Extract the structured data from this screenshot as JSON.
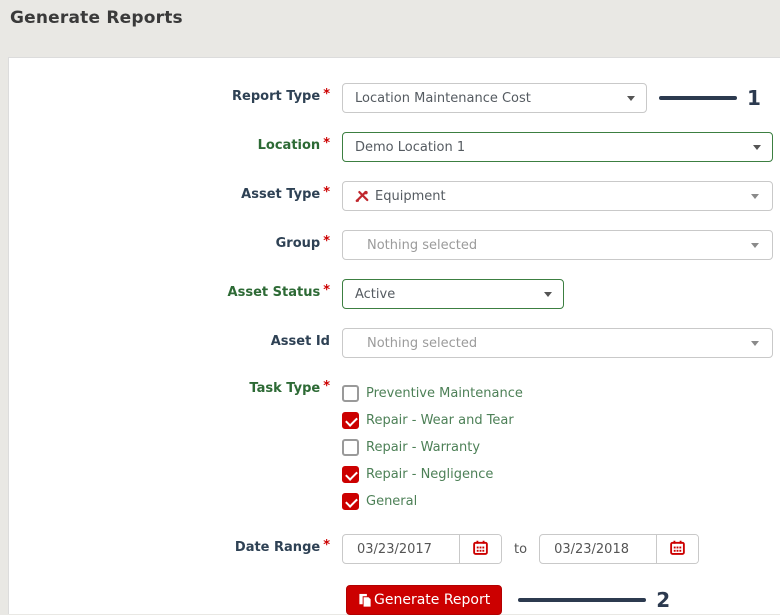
{
  "page": {
    "title": "Generate Reports"
  },
  "fields": {
    "report_type": {
      "label": "Report Type",
      "required_mark": "*",
      "value": "Location Maintenance Cost"
    },
    "location": {
      "label": "Location",
      "required_mark": "*",
      "value": "Demo Location 1"
    },
    "asset_type": {
      "label": "Asset Type",
      "required_mark": "*",
      "value": "Equipment",
      "icon": "tools-icon"
    },
    "group": {
      "label": "Group",
      "required_mark": "*",
      "placeholder": "Nothing selected"
    },
    "asset_status": {
      "label": "Asset Status",
      "required_mark": "*",
      "value": "Active"
    },
    "asset_id": {
      "label": "Asset Id",
      "placeholder": "Nothing selected"
    },
    "task_type": {
      "label": "Task Type",
      "required_mark": "*",
      "options": [
        {
          "label": "Preventive Maintenance",
          "checked": false
        },
        {
          "label": "Repair - Wear and Tear",
          "checked": true
        },
        {
          "label": "Repair - Warranty",
          "checked": false
        },
        {
          "label": "Repair - Negligence",
          "checked": true
        },
        {
          "label": "General",
          "checked": true
        }
      ]
    },
    "date_range": {
      "label": "Date Range",
      "required_mark": "*",
      "start_value": "03/23/2017",
      "separator": "to",
      "end_value": "03/23/2018",
      "icon": "calendar-icon"
    }
  },
  "actions": {
    "generate_report_label": "Generate Report",
    "icon": "report-file-icon"
  },
  "annotations": {
    "step1": "1",
    "step2": "2"
  },
  "colors": {
    "accent_red": "#cc0000",
    "valid_green_border": "#3c7f41",
    "label_navy": "#2e4154",
    "label_green": "#2d6a35",
    "checkbox_text_green": "#4d8057",
    "annotation_navy": "#2c3a4f"
  }
}
